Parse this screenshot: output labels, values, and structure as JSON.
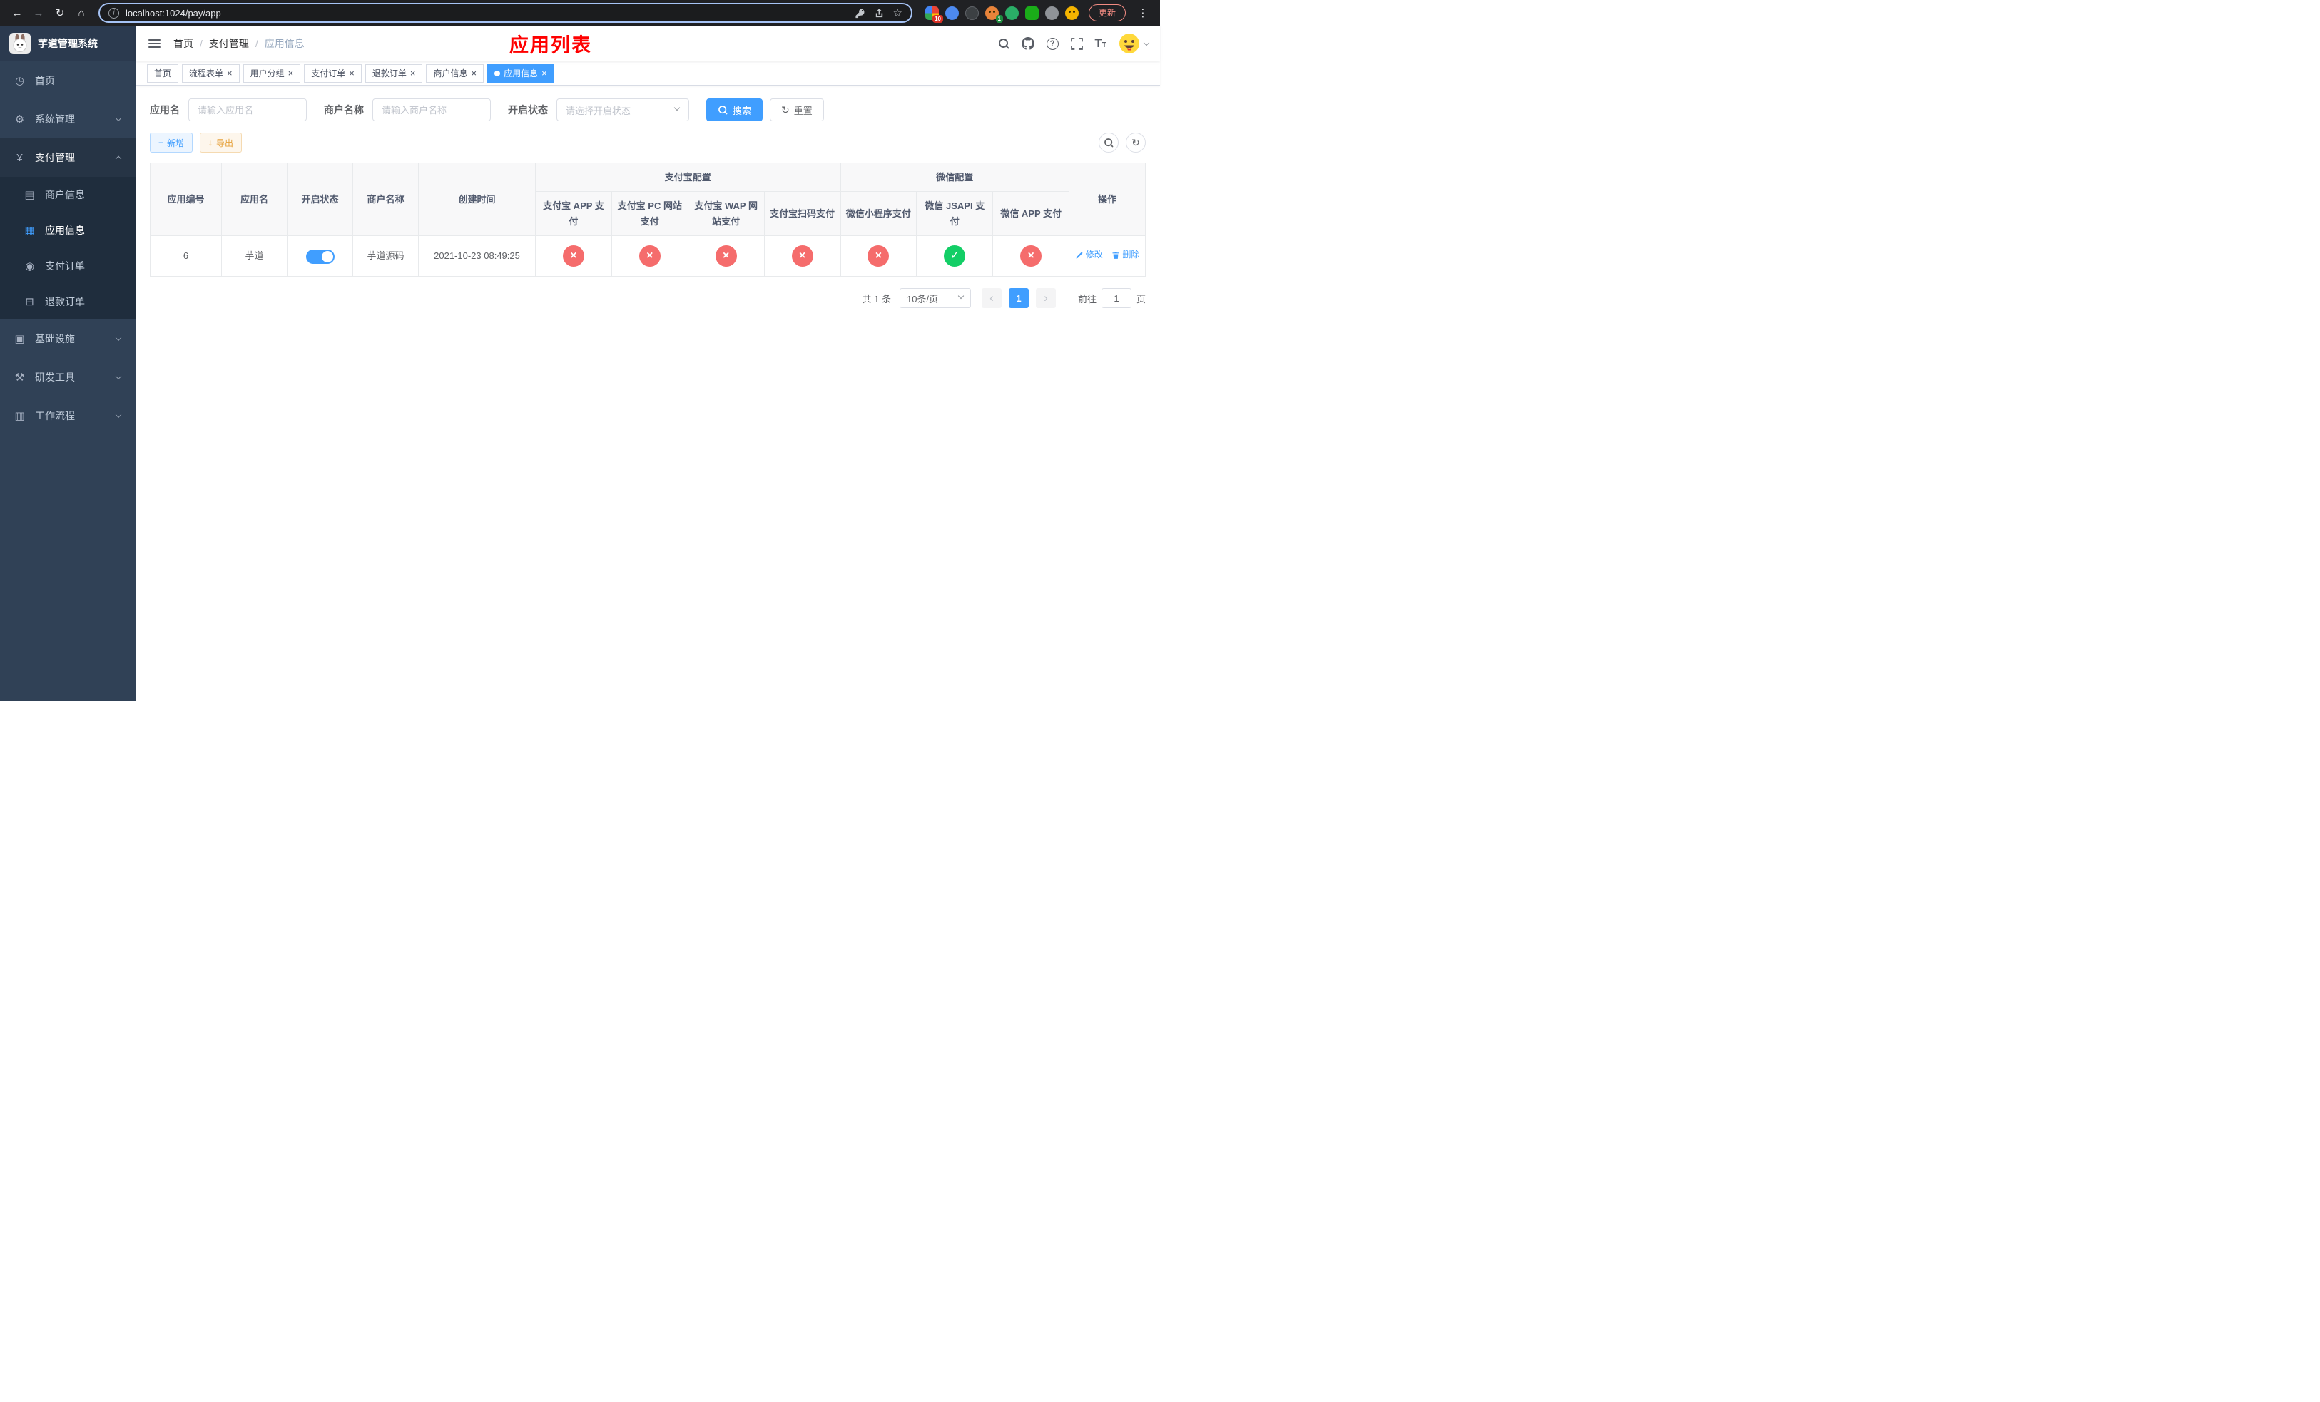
{
  "browser": {
    "url": "localhost:1024/pay/app",
    "update_label": "更新",
    "ext_badge_1": "10",
    "ext_badge_2": "1"
  },
  "icons": {
    "back": "←",
    "forward": "→",
    "reload": "↻",
    "home": "⌂",
    "info": "i",
    "star": "☆",
    "menu_dots": "⋮",
    "dashboard": "◷",
    "gear": "⚙",
    "yen": "¥",
    "merchant": "▤",
    "app": "▦",
    "order": "◉",
    "refund": "⊟",
    "infra": "▣",
    "tools": "⚒",
    "workflow": "▥",
    "plus": "+",
    "download": "↓",
    "check": "✓",
    "cross": "×",
    "close": "×",
    "prev": "‹",
    "next": "›",
    "question": "?",
    "font_size": "T"
  },
  "app": {
    "name": "芋道管理系统"
  },
  "sidebar": {
    "items": [
      {
        "label": "首页"
      },
      {
        "label": "系统管理"
      },
      {
        "label": "支付管理"
      },
      {
        "label": "基础设施"
      },
      {
        "label": "研发工具"
      },
      {
        "label": "工作流程"
      }
    ],
    "submenu": [
      {
        "label": "商户信息"
      },
      {
        "label": "应用信息"
      },
      {
        "label": "支付订单"
      },
      {
        "label": "退款订单"
      }
    ]
  },
  "header": {
    "breadcrumb": [
      "首页",
      "支付管理",
      "应用信息"
    ],
    "page_title": "应用列表"
  },
  "tabs": [
    {
      "label": "首页"
    },
    {
      "label": "流程表单"
    },
    {
      "label": "用户分组"
    },
    {
      "label": "支付订单"
    },
    {
      "label": "退款订单"
    },
    {
      "label": "商户信息"
    },
    {
      "label": "应用信息"
    }
  ],
  "filters": {
    "app_name_label": "应用名",
    "app_name_placeholder": "请输入应用名",
    "merchant_label": "商户名称",
    "merchant_placeholder": "请输入商户名称",
    "status_label": "开启状态",
    "status_placeholder": "请选择开启状态",
    "search_label": "搜索",
    "reset_label": "重置"
  },
  "toolbar": {
    "add_label": "新增",
    "export_label": "导出"
  },
  "table": {
    "col_headers": [
      "应用编号",
      "应用名",
      "开启状态",
      "商户名称",
      "创建时间"
    ],
    "alipay_group": "支付宝配置",
    "alipay_cols": [
      "支付宝 APP 支付",
      "支付宝 PC 网站支付",
      "支付宝 WAP 网站支付",
      "支付宝扫码支付"
    ],
    "wechat_group": "微信配置",
    "wechat_cols": [
      "微信小程序支付",
      "微信 JSAPI 支付",
      "微信 APP 支付"
    ],
    "ops_header": "操作",
    "row": {
      "id": "6",
      "name": "芋道",
      "status_on": true,
      "merchant": "芋道源码",
      "created_at": "2021-10-23 08:49:25",
      "config_status": [
        false,
        false,
        false,
        false,
        false,
        true,
        false
      ],
      "edit_label": "修改",
      "delete_label": "删除"
    }
  },
  "pagination": {
    "total_text": "共 1 条",
    "page_size_text": "10条/页",
    "current_page": "1",
    "goto_prefix": "前往",
    "goto_value": "1",
    "goto_suffix": "页"
  },
  "colors": {
    "accent": "#409eff",
    "success": "#13ce66",
    "danger": "#f56c6c",
    "title_red": "#ff0000",
    "sidebar_bg": "#304156"
  }
}
